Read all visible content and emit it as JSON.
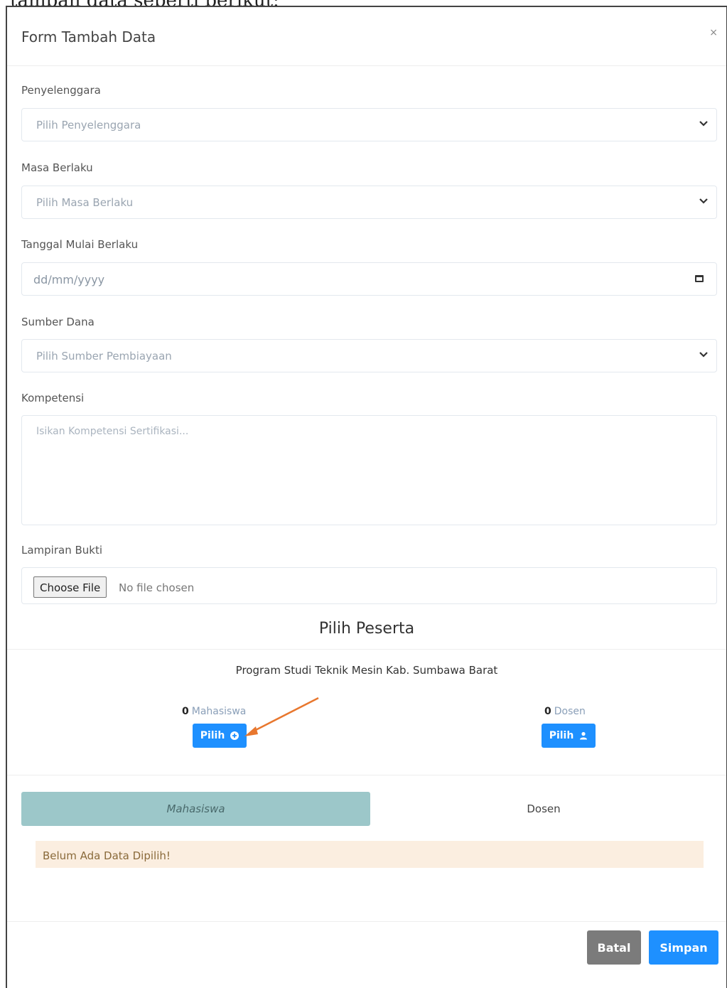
{
  "caption": "tambah data seperti berikut:",
  "modal": {
    "title": "Form Tambah Data",
    "close": "×"
  },
  "form": {
    "penyelenggara": {
      "label": "Penyelenggara",
      "placeholder": "Pilih Penyelenggara"
    },
    "masa_berlaku": {
      "label": "Masa Berlaku",
      "placeholder": "Pilih Masa Berlaku"
    },
    "tanggal_mulai": {
      "label": "Tanggal Mulai Berlaku",
      "placeholder": "dd/mm/yyyy"
    },
    "sumber_dana": {
      "label": "Sumber Dana",
      "placeholder": "Pilih Sumber Pembiayaan"
    },
    "kompetensi": {
      "label": "Kompetensi",
      "placeholder": "Isikan Kompetensi Sertifikasi..."
    },
    "lampiran": {
      "label": "Lampiran Bukti",
      "button": "Choose File",
      "status": "No file chosen"
    }
  },
  "peserta": {
    "title": "Pilih Peserta",
    "prodi": "Program Studi Teknik Mesin Kab. Sumbawa Barat",
    "mahasiswa": {
      "count": "0",
      "label": "Mahasiswa",
      "button": "Pilih"
    },
    "dosen": {
      "count": "0",
      "label": "Dosen",
      "button": "Pilih"
    }
  },
  "tabs": [
    {
      "label": "Mahasiswa",
      "active": true
    },
    {
      "label": "Dosen",
      "active": false
    }
  ],
  "alert": "Belum Ada Data Dipilih!",
  "footer": {
    "cancel": "Batal",
    "save": "Simpan"
  },
  "colors": {
    "primary": "#1e90ff",
    "cancel": "#7b7b7b",
    "tab_active": "#9cc7c9",
    "alert_bg": "#fbeee0",
    "arrow": "#e8772e"
  },
  "icons": {
    "chevron": "chevron-down-icon",
    "calendar": "calendar-icon",
    "plus": "plus-circle-icon",
    "user": "user-icon",
    "arrow": "annotation-arrow"
  }
}
